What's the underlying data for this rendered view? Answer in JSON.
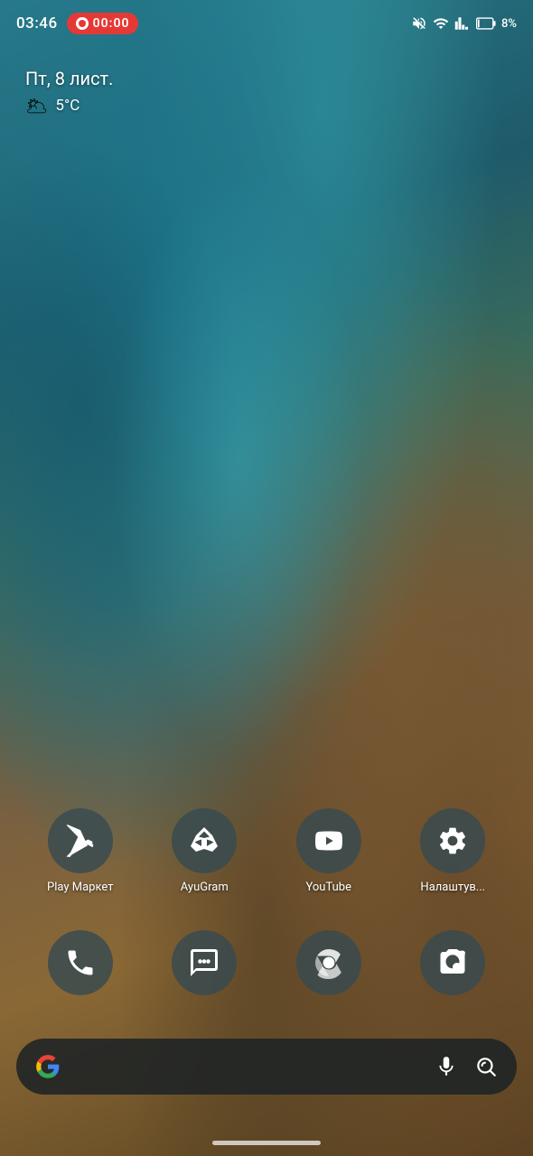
{
  "statusBar": {
    "time": "03:46",
    "recording": "00:00",
    "battery": "8%"
  },
  "dateWidget": {
    "date": "Пт, 8 лист.",
    "weather": "5°C"
  },
  "appRow1": [
    {
      "id": "play-market",
      "label": "Play Маркет",
      "icon": "playmarket"
    },
    {
      "id": "ayugram",
      "label": "AyuGram",
      "icon": "ayugram"
    },
    {
      "id": "youtube",
      "label": "YouTube",
      "icon": "youtube"
    },
    {
      "id": "settings",
      "label": "Налаштув...",
      "icon": "settings"
    }
  ],
  "appRow2": [
    {
      "id": "phone",
      "label": "",
      "icon": "phone"
    },
    {
      "id": "messages",
      "label": "",
      "icon": "messages"
    },
    {
      "id": "chrome",
      "label": "",
      "icon": "chrome"
    },
    {
      "id": "camera",
      "label": "",
      "icon": "camera"
    }
  ],
  "searchBar": {
    "googleLabel": "G",
    "micLabel": "mic",
    "lensLabel": "lens"
  }
}
